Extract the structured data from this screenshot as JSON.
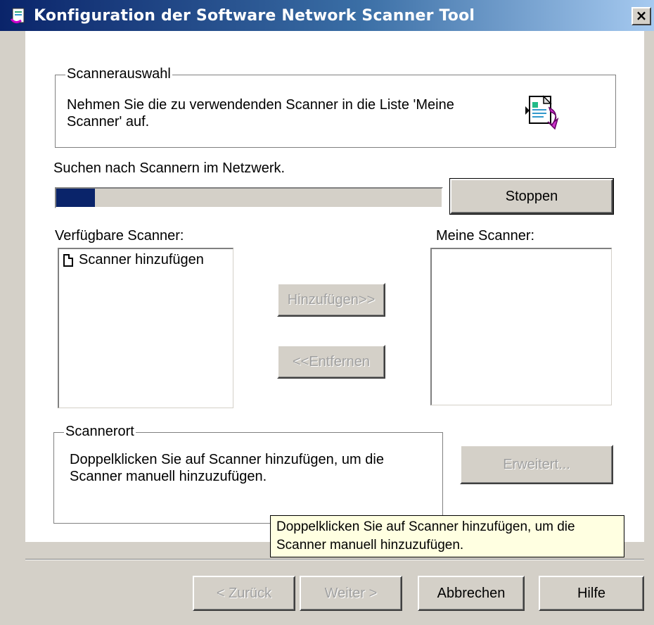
{
  "window": {
    "title": "Konfiguration der Software Network Scanner Tool",
    "close_label": "×"
  },
  "scanner_selection": {
    "legend": "Scannerauswahl",
    "description": "Nehmen Sie die zu verwendenden Scanner in die Liste 'Meine Scanner' auf."
  },
  "search": {
    "status": "Suchen nach Scannern im Netzwerk.",
    "progress_percent": 10,
    "stop_label": "Stoppen"
  },
  "available": {
    "label": "Verfügbare Scanner:",
    "items": [
      "Scanner hinzufügen"
    ]
  },
  "mine": {
    "label": "Meine Scanner:",
    "items": []
  },
  "actions": {
    "add_label": "Hinzufügen>>",
    "remove_label": "<<Entfernen",
    "advanced_label": "Erweitert..."
  },
  "location": {
    "legend": "Scannerort",
    "description": "Doppelklicken Sie auf Scanner hinzufügen, um die Scanner manuell hinzuzufügen."
  },
  "tooltip": {
    "text": "Doppelklicken Sie auf Scanner hinzufügen, um die Scanner manuell hinzuzufügen."
  },
  "footer": {
    "back_label": "< Zurück",
    "next_label": "Weiter >",
    "cancel_label": "Abbrechen",
    "help_label": "Hilfe"
  },
  "colors": {
    "titlebar_start": "#0a246a",
    "titlebar_end": "#a6caf0",
    "progress_fill": "#0a246a",
    "tooltip_bg": "#ffffe1"
  }
}
